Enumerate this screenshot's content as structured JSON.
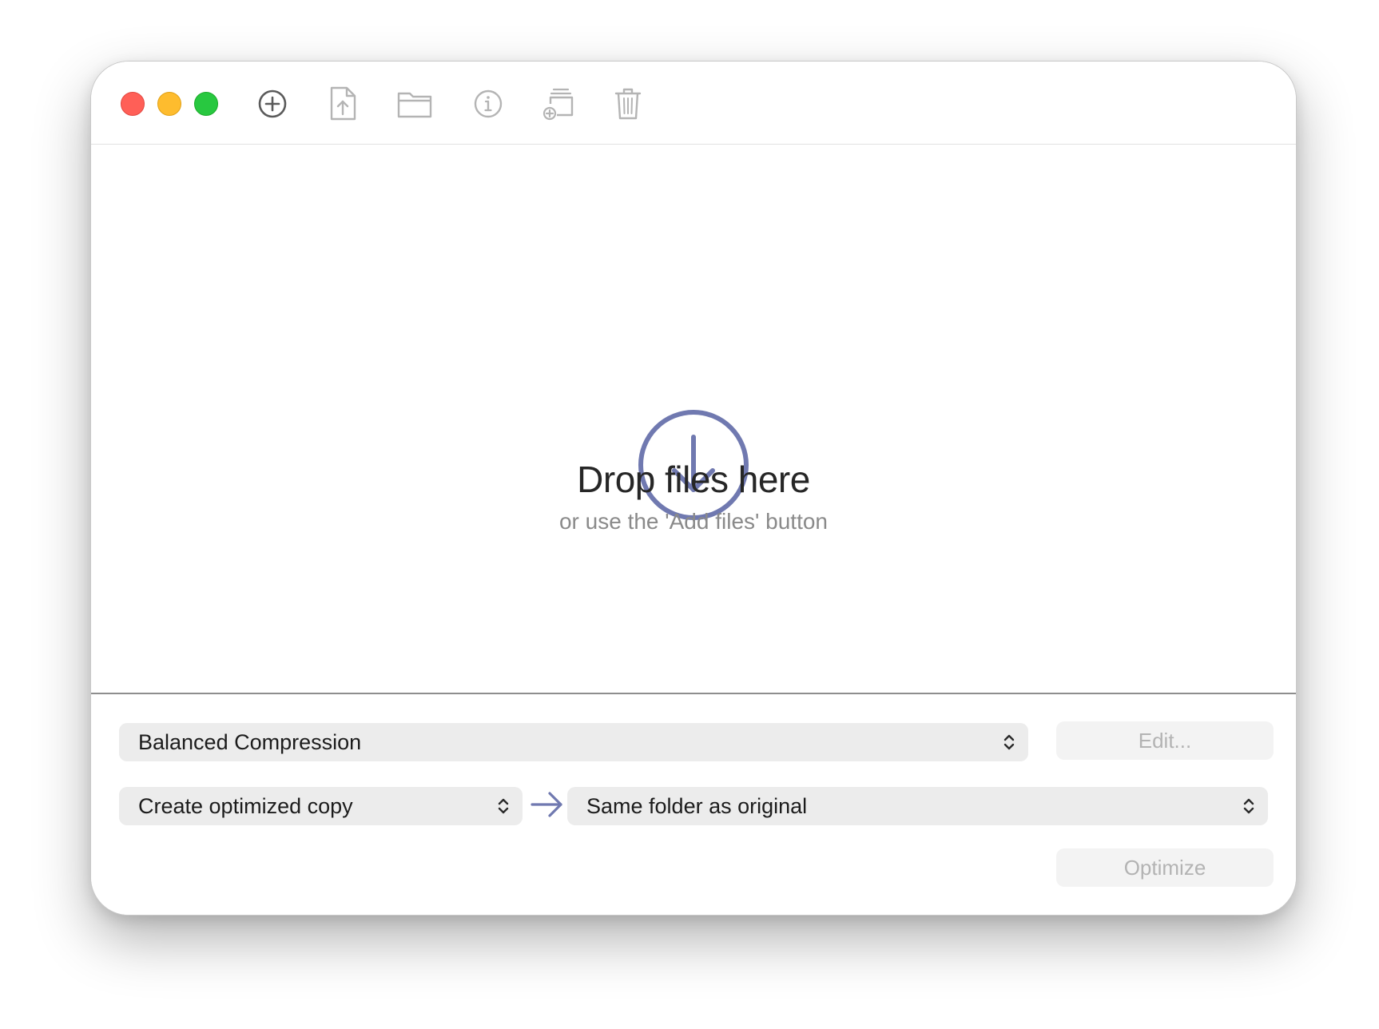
{
  "window": {
    "accent_color": "#7079b0"
  },
  "toolbar": {
    "icons": [
      "add-icon",
      "export-file-icon",
      "folder-icon",
      "info-icon",
      "add-stack-icon",
      "trash-icon"
    ]
  },
  "drop_zone": {
    "title": "Drop files here",
    "subtitle": "or use the 'Add files' button"
  },
  "settings": {
    "preset": "Balanced Compression",
    "edit_label": "Edit...",
    "mode": "Create optimized copy",
    "destination": "Same folder as original",
    "optimize_label": "Optimize"
  }
}
